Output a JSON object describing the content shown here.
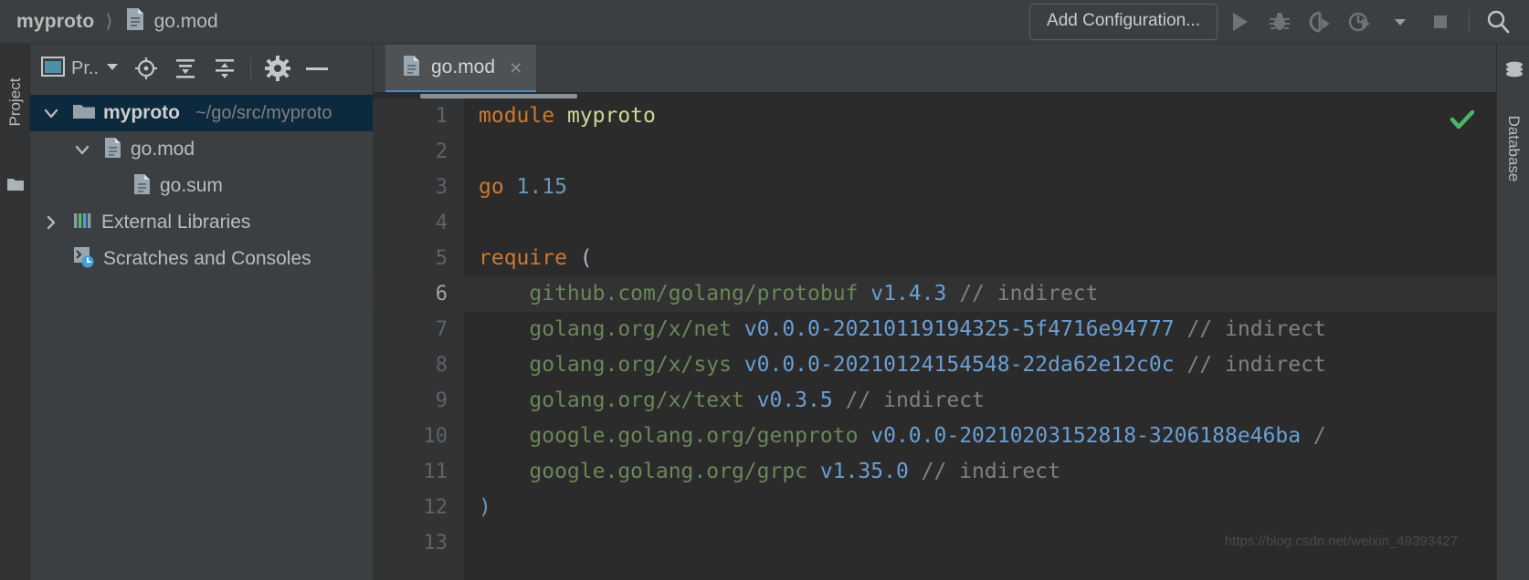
{
  "breadcrumb": {
    "project": "myproto",
    "separator": "〉",
    "file": "go.mod"
  },
  "toolbar": {
    "add_configuration": "Add Configuration...",
    "icons": [
      "run-icon",
      "debug-icon",
      "run-with-coverage-icon",
      "profile-icon",
      "chevron-down-icon",
      "stop-icon",
      "search-icon"
    ]
  },
  "left_rail": {
    "label": "Project",
    "icon": "folder-icon"
  },
  "right_rail": {
    "label": "Database",
    "icon": "database-icon"
  },
  "project_panel": {
    "title": "Pr..",
    "title_icon": "project-view-icon",
    "dropdown_icon": "chevron-down-icon",
    "buttons": [
      "locate-icon",
      "expand-all-icon",
      "collapse-all-icon",
      "settings-gear-icon",
      "hide-panel-icon"
    ],
    "tree": [
      {
        "label": "myproto",
        "path": "~/go/src/myproto",
        "icon": "folder-icon",
        "arrow": "expanded",
        "indent": 0,
        "bold": true,
        "selected": true
      },
      {
        "label": "go.mod",
        "path": "",
        "icon": "file-icon",
        "arrow": "expanded",
        "indent": 1,
        "bold": false,
        "selected": false
      },
      {
        "label": "go.sum",
        "path": "",
        "icon": "file-icon",
        "arrow": "none",
        "indent": 2,
        "bold": false,
        "selected": false
      },
      {
        "label": "External Libraries",
        "path": "",
        "icon": "libraries-icon",
        "arrow": "collapsed",
        "indent": 0,
        "bold": false,
        "selected": false
      },
      {
        "label": "Scratches and Consoles",
        "path": "",
        "icon": "scratches-icon",
        "arrow": "none",
        "indent": 0,
        "bold": false,
        "selected": false
      }
    ]
  },
  "editor": {
    "tab": {
      "label": "go.mod",
      "icon": "file-icon",
      "close": "×"
    },
    "status_icon": "inspection-ok-checkmark",
    "watermark": "https://blog.csdn.net/weixin_49393427",
    "lines": [
      {
        "n": "1",
        "caret": false,
        "tokens": [
          {
            "t": "module ",
            "c": "kw"
          },
          {
            "t": "myproto",
            "c": "mod"
          }
        ]
      },
      {
        "n": "2",
        "caret": false,
        "tokens": []
      },
      {
        "n": "3",
        "caret": false,
        "tokens": [
          {
            "t": "go ",
            "c": "kw"
          },
          {
            "t": "1.15",
            "c": "num"
          }
        ]
      },
      {
        "n": "4",
        "caret": false,
        "tokens": []
      },
      {
        "n": "5",
        "caret": false,
        "tokens": [
          {
            "t": "require ",
            "c": "kw"
          },
          {
            "t": "(",
            "c": "ident"
          }
        ]
      },
      {
        "n": "6",
        "caret": true,
        "tokens": [
          {
            "t": "    github.com/golang/protobuf ",
            "c": "path"
          },
          {
            "t": "v1.4.3",
            "c": "ver"
          },
          {
            "t": " // indirect",
            "c": "cmt"
          }
        ]
      },
      {
        "n": "7",
        "caret": false,
        "tokens": [
          {
            "t": "    golang.org/x/net ",
            "c": "path"
          },
          {
            "t": "v0.0.0-20210119194325-5f4716e94777",
            "c": "ver"
          },
          {
            "t": " // indirect",
            "c": "cmt"
          }
        ]
      },
      {
        "n": "8",
        "caret": false,
        "tokens": [
          {
            "t": "    golang.org/x/sys ",
            "c": "path"
          },
          {
            "t": "v0.0.0-20210124154548-22da62e12c0c",
            "c": "ver"
          },
          {
            "t": " // indirect",
            "c": "cmt"
          }
        ]
      },
      {
        "n": "9",
        "caret": false,
        "tokens": [
          {
            "t": "    golang.org/x/text ",
            "c": "path"
          },
          {
            "t": "v0.3.5",
            "c": "ver"
          },
          {
            "t": " // indirect",
            "c": "cmt"
          }
        ]
      },
      {
        "n": "10",
        "caret": false,
        "tokens": [
          {
            "t": "    google.golang.org/genproto ",
            "c": "path"
          },
          {
            "t": "v0.0.0-20210203152818-3206188e46ba",
            "c": "ver"
          },
          {
            "t": " /",
            "c": "cmt"
          }
        ]
      },
      {
        "n": "11",
        "caret": false,
        "tokens": [
          {
            "t": "    google.golang.org/grpc ",
            "c": "path"
          },
          {
            "t": "v1.35.0",
            "c": "ver"
          },
          {
            "t": " // indirect",
            "c": "cmt"
          }
        ]
      },
      {
        "n": "12",
        "caret": false,
        "tokens": [
          {
            "t": ")",
            "c": "punct"
          }
        ]
      },
      {
        "n": "13",
        "caret": false,
        "tokens": []
      }
    ]
  },
  "colors": {
    "accent_tab": "#4a88c7",
    "selection": "#0d293e",
    "keyword": "#cc7832",
    "module_name": "#ced894",
    "path": "#6a8759",
    "version": "#6a9fd4",
    "comment": "#808080",
    "number": "#6897bb",
    "ok_green": "#49b865"
  }
}
